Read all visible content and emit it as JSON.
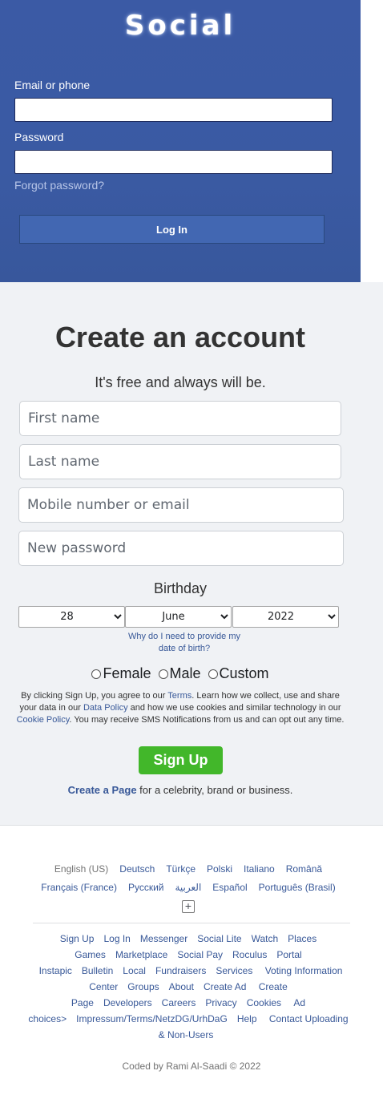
{
  "login": {
    "logo": "Social",
    "email_label": "Email or phone",
    "email_value": "",
    "password_label": "Password",
    "password_value": "",
    "forgot": "Forgot password?",
    "login_button": "Log In"
  },
  "signup": {
    "title": "Create an account",
    "tagline": "It's free and always will be.",
    "first_name_placeholder": "First name",
    "last_name_placeholder": "Last name",
    "contact_placeholder": "Mobile number or email",
    "password_placeholder": "New password",
    "birthday_title": "Birthday",
    "day": "28",
    "month": "June",
    "year": "2022",
    "why_link": "Why do I need to provide my date of birth?",
    "gender": {
      "female": "Female",
      "male": "Male",
      "custom": "Custom"
    },
    "terms": {
      "t1": "By clicking Sign Up, you agree to our ",
      "terms_link": "Terms",
      "t2": ". Learn how we collect, use and share your data in our ",
      "data_policy_link": "Data Policy",
      "t3": " and how we use cookies and similar technology in our ",
      "cookie_policy_link": "Cookie Policy",
      "t4": ". You may receive SMS Notifications from us and can opt out any time."
    },
    "signup_button": "Sign Up",
    "create_page_link": "Create a Page",
    "create_page_text": " for a celebrity, brand or business."
  },
  "footer": {
    "current_language": "English (US)",
    "languages": [
      "Deutsch",
      "Türkçe",
      "Polski",
      "Italiano",
      "Română",
      "Français (France)",
      "Русский",
      "العربية",
      "Español",
      "Português (Brasil)"
    ],
    "more_languages_icon": "plus-box-icon",
    "links": [
      "Sign Up",
      "Log In",
      "Messenger",
      "Social Lite",
      "Watch",
      "Places",
      "Games",
      "Marketplace",
      "Social Pay",
      "Roculus",
      "Portal",
      "Instapic",
      "Bulletin",
      "Local",
      "Fundraisers",
      "Services",
      "Voting Information Center",
      "Groups",
      "About",
      "Create Ad",
      "Create Page",
      "Developers",
      "Careers",
      "Privacy",
      "Cookies",
      "Ad choices>",
      "Impressum/Terms/NetzDG/UrhDaG",
      "Help",
      "Contact Uploading & Non-Users"
    ],
    "coded_by": "Coded by Rami Al-Saadi © 2022"
  },
  "colors": {
    "login_background": "#3b5998",
    "login_button": "#4267b2",
    "signup_button": "#42b72a",
    "link": "#385898",
    "page_background": "#f0f2f5"
  }
}
